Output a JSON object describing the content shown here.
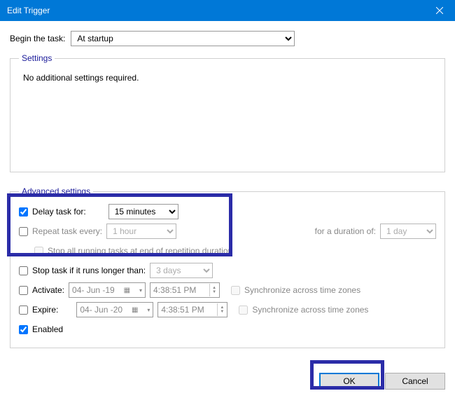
{
  "window": {
    "title": "Edit Trigger"
  },
  "begin": {
    "label": "Begin the task:",
    "value": "At startup"
  },
  "settings_group": {
    "legend": "Settings",
    "message": "No additional settings required."
  },
  "advanced": {
    "legend": "Advanced settings",
    "delay": {
      "label": "Delay task for:",
      "value": "15 minutes",
      "checked": true
    },
    "repeat": {
      "label": "Repeat task every:",
      "value": "1 hour",
      "checked": false,
      "duration_label": "for a duration of:",
      "duration_value": "1 day"
    },
    "stop_end": {
      "label": "Stop all running tasks at end of repetition duration",
      "checked": false
    },
    "stop_if": {
      "label": "Stop task if it runs longer than:",
      "value": "3 days",
      "checked": false
    },
    "activate": {
      "label": "Activate:",
      "date": "04- Jun -19",
      "time": "4:38:51 PM",
      "checked": false,
      "sync_label": "Synchronize across time zones",
      "sync_checked": false
    },
    "expire": {
      "label": "Expire:",
      "date": "04- Jun -20",
      "time": "4:38:51 PM",
      "checked": false,
      "sync_label": "Synchronize across time zones",
      "sync_checked": false
    },
    "enabled": {
      "label": "Enabled",
      "checked": true
    }
  },
  "buttons": {
    "ok": "OK",
    "cancel": "Cancel"
  }
}
